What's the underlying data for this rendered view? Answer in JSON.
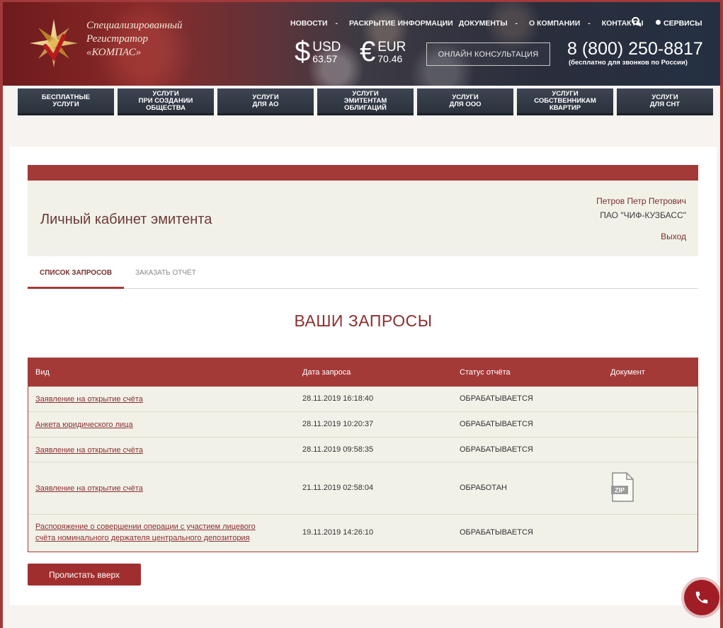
{
  "brand": {
    "line1": "Специализированный",
    "line2": "Регистратор",
    "line3": "«КОМПАС»"
  },
  "topnav": {
    "items": [
      {
        "label": "НОВОСТИ",
        "sep": "-"
      },
      {
        "label": "РАСКРЫТИЕ ИНФОРМАЦИИ",
        "sep": ""
      },
      {
        "label": "ДОКУМЕНТЫ",
        "sep": "-"
      },
      {
        "label": "О КОМПАНИИ",
        "sep": "-"
      },
      {
        "label": "КОНТАКТЫ",
        "sep": ""
      }
    ],
    "services": "СЕРВИСЫ"
  },
  "currency": {
    "usd": {
      "symbol": "$",
      "code": "USD",
      "value": "63.57"
    },
    "eur": {
      "symbol": "€",
      "code": "EUR",
      "value": "70.46"
    }
  },
  "online_consult": "ОНЛАЙН КОНСУЛЬТАЦИЯ",
  "phone": {
    "number": "8 (800) 250-8817",
    "note": "(бесплатно для звонков по России)"
  },
  "service_buttons": [
    {
      "l1": "БЕСПЛАТНЫЕ",
      "l2": "УСЛУГИ",
      "l3": ""
    },
    {
      "l1": "УСЛУГИ",
      "l2": "ПРИ СОЗДАНИИ",
      "l3": "ОБЩЕСТВА"
    },
    {
      "l1": "УСЛУГИ",
      "l2": "ДЛЯ АО",
      "l3": ""
    },
    {
      "l1": "УСЛУГИ",
      "l2": "ЭМИТЕНТАМ",
      "l3": "ОБЛИГАЦИЙ"
    },
    {
      "l1": "УСЛУГИ",
      "l2": "ДЛЯ ООО",
      "l3": ""
    },
    {
      "l1": "УСЛУГИ",
      "l2": "СОБСТВЕННИКАМ",
      "l3": "КВАРТИР"
    },
    {
      "l1": "УСЛУГИ",
      "l2": "ДЛЯ СНТ",
      "l3": ""
    }
  ],
  "cabinet": {
    "title": "Личный кабинет эмитента",
    "user": "Петров Петр Петрович",
    "company": "ПАО \"ЧИФ-КУЗБАСС\"",
    "logout": "Выход"
  },
  "tabs": [
    {
      "label": "СПИСОК ЗАПРОСОВ",
      "active": true
    },
    {
      "label": "ЗАКАЗАТЬ ОТЧЁТ",
      "active": false
    }
  ],
  "heading": "ВАШИ ЗАПРОСЫ",
  "table": {
    "headers": {
      "type": "Вид",
      "date": "Дата запроса",
      "status": "Статус отчёта",
      "doc": "Документ"
    },
    "rows": [
      {
        "type": "Заявление на открытие счёта",
        "type2": "",
        "date": "28.11.2019 16:18:40",
        "status": "ОБРАБАТЫВАЕТСЯ",
        "doc": ""
      },
      {
        "type": "Анкета юридического лица",
        "type2": "",
        "date": "28.11.2019 10:20:37",
        "status": "ОБРАБАТЫВАЕТСЯ",
        "doc": ""
      },
      {
        "type": "Заявление на открытие счёта",
        "type2": "",
        "date": "28.11.2019 09:58:35",
        "status": "ОБРАБАТЫВАЕТСЯ",
        "doc": ""
      },
      {
        "type": "Заявление на открытие счёта",
        "type2": "",
        "date": "21.11.2019 02:58:04",
        "status": "ОБРАБОТАН",
        "doc": "ZIP"
      },
      {
        "type": "Распоряжение о совершении операции с участием лицевого",
        "type2": "счёта номинального держателя центрального депозитория",
        "date": "19.11.2019 14:26:10",
        "status": "ОБРАБАТЫВАЕТСЯ",
        "doc": ""
      }
    ]
  },
  "scroll_top": "Пролистать вверх",
  "colors": {
    "accent": "#a33a38",
    "panel": "#f2f1e8",
    "dark_button": "#2f3640"
  }
}
